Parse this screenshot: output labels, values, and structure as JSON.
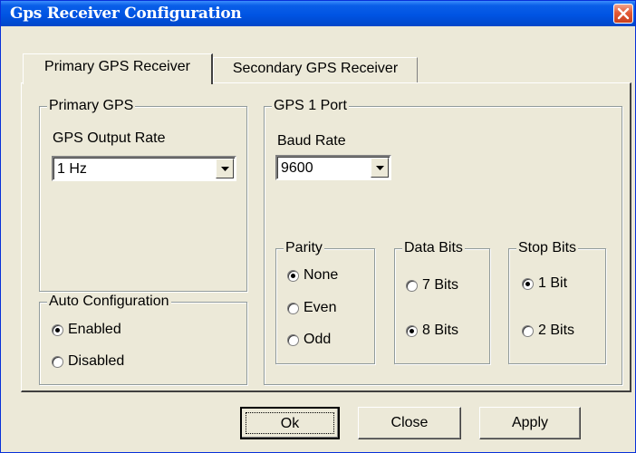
{
  "window": {
    "title": "Gps Receiver Configuration"
  },
  "tabs": [
    {
      "label": "Primary GPS Receiver",
      "active": true
    },
    {
      "label": "Secondary GPS Receiver",
      "active": false
    }
  ],
  "primary_gps": {
    "legend": "Primary GPS",
    "output_rate_label": "GPS Output Rate",
    "output_rate_value": "1 Hz"
  },
  "auto_config": {
    "legend": "Auto Configuration",
    "options": [
      {
        "label": "Enabled",
        "selected": true
      },
      {
        "label": "Disabled",
        "selected": false
      }
    ]
  },
  "gps_port": {
    "legend": "GPS 1 Port",
    "baud_label": "Baud Rate",
    "baud_value": "9600",
    "parity": {
      "legend": "Parity",
      "options": [
        {
          "label": "None",
          "selected": true
        },
        {
          "label": "Even",
          "selected": false
        },
        {
          "label": "Odd",
          "selected": false
        }
      ]
    },
    "data_bits": {
      "legend": "Data Bits",
      "options": [
        {
          "label": "7 Bits",
          "selected": false
        },
        {
          "label": "8 Bits",
          "selected": true
        }
      ]
    },
    "stop_bits": {
      "legend": "Stop Bits",
      "options": [
        {
          "label": "1 Bit",
          "selected": true
        },
        {
          "label": "2 Bits",
          "selected": false
        }
      ]
    }
  },
  "buttons": {
    "ok": "Ok",
    "close": "Close",
    "apply": "Apply"
  },
  "icons": {
    "close": "close-icon",
    "dropdown": "chevron-down-icon"
  }
}
